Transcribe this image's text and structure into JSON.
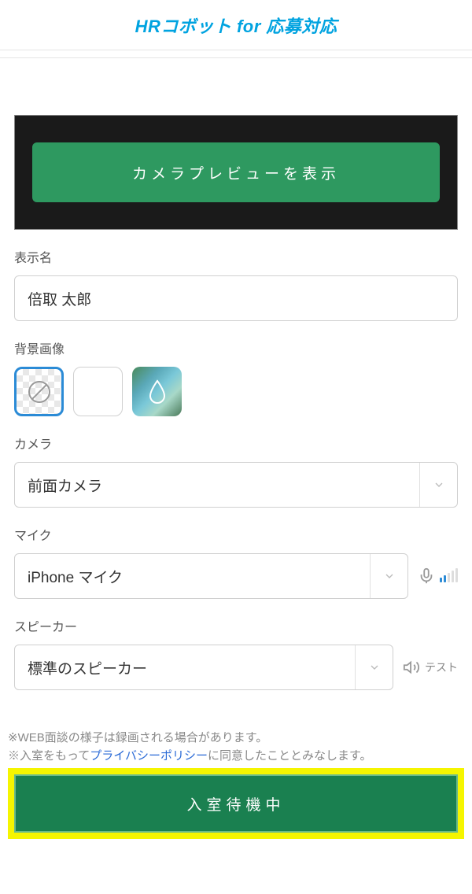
{
  "header": {
    "logo_text": "HRコボット for 応募対応"
  },
  "preview": {
    "button_label": "カメラプレビューを表示"
  },
  "display_name": {
    "label": "表示名",
    "value": "倍取 太郎"
  },
  "background": {
    "label": "背景画像",
    "options": [
      "none",
      "white",
      "blur-image"
    ],
    "selected": "none"
  },
  "camera": {
    "label": "カメラ",
    "value": "前面カメラ"
  },
  "mic": {
    "label": "マイク",
    "value": "iPhone マイク",
    "level": 2
  },
  "speaker": {
    "label": "スピーカー",
    "value": "標準のスピーカー",
    "test_label": "テスト"
  },
  "notices": {
    "line1": "※WEB面談の様子は録画される場合があります。",
    "line2_pre": "※入室をもって",
    "privacy_link": "プライバシーポリシー",
    "line2_post": "に同意したこととみなします。"
  },
  "enter_button": {
    "label": "入室待機中"
  }
}
